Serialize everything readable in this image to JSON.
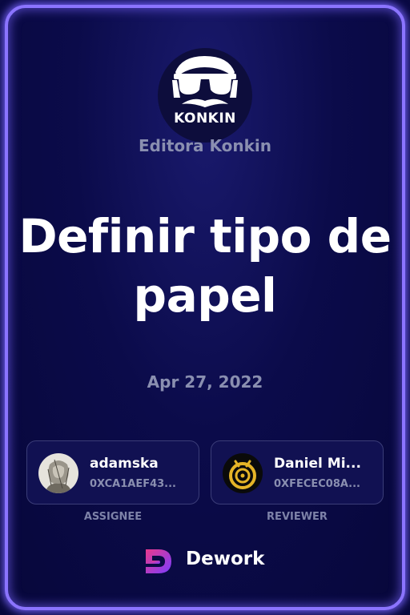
{
  "org": {
    "name": "Editora Konkin",
    "logo_text": "KONKIN",
    "logo_icon": "sunglasses-mustache-face-icon"
  },
  "task": {
    "title": "Definir tipo de papel",
    "date": "Apr 27, 2022"
  },
  "assignee": {
    "name": "adamska",
    "address": "0XCA1AEF43...",
    "role_label": "ASSIGNEE",
    "avatar_icon": "sketch-portrait-avatar"
  },
  "reviewer": {
    "name": "Daniel Mi...",
    "address": "0XFECEC08A...",
    "role_label": "REVIEWER",
    "avatar_icon": "golden-spiral-avatar"
  },
  "brand": {
    "name": "Dework",
    "icon": "dework-logo-icon"
  },
  "colors": {
    "background": "#0b0b4a",
    "frame_glow": "#8b74ff",
    "muted_text": "#8a8fb0",
    "card_fill": "#111152",
    "card_border": "#3b3d78",
    "brand_gradient_start": "#e83a8c",
    "brand_gradient_end": "#7b3cff"
  }
}
